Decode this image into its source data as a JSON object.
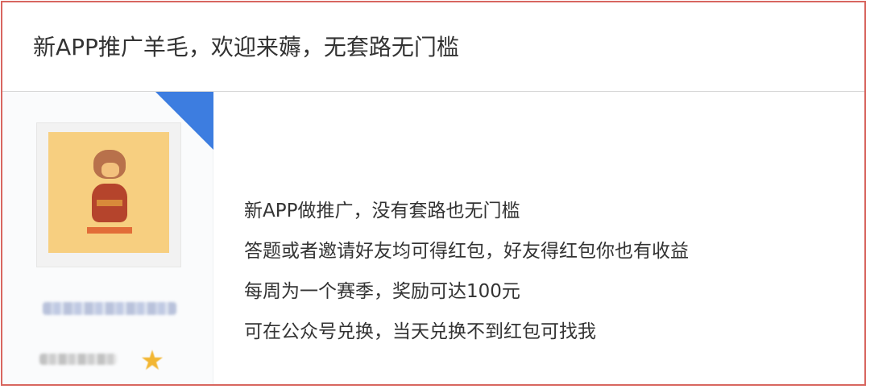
{
  "thread": {
    "title": "新APP推广羊毛，欢迎来薅，无套路无门槛"
  },
  "author": {
    "badge_icon": "blue-corner-badge",
    "avatar_icon": "pixel-character-avatar",
    "level_icon": "gold-star-medal"
  },
  "post": {
    "lines": [
      "新APP做推广，没有套路也无门槛",
      "答题或者邀请好友均可得红包，好友得红包你也有收益",
      "每周为一个赛季，奖励可达100元",
      "可在公众号兑换，当天兑换不到红包可找我"
    ]
  },
  "colors": {
    "frame_border": "#d8665f",
    "badge_blue": "#3d7de0",
    "text": "#333333"
  }
}
